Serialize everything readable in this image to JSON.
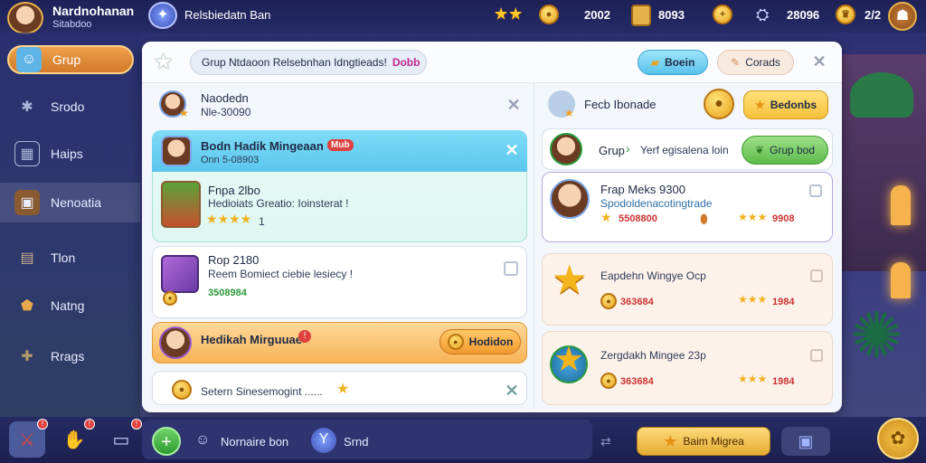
{
  "top": {
    "player_name": "Nardnohanan",
    "player_sub": "Sitabdoo",
    "guild_name": "Relsbiedatn Ban",
    "stars_value": "2002",
    "chest_value": "8093",
    "gear_value": "28096",
    "right_value": "2/2"
  },
  "sidebar": {
    "items": [
      {
        "label": "Grup"
      },
      {
        "label": "Srodo"
      },
      {
        "label": "Haips"
      },
      {
        "label": "Nenoatia"
      },
      {
        "label": "Tlon"
      },
      {
        "label": "Natng"
      },
      {
        "label": "Rrags"
      }
    ]
  },
  "panel": {
    "header_text": "Grup Ntdaoon Relsebnhan Idngtieads!",
    "header_tag": "Dobb",
    "btn_primary": "Boein",
    "btn_secondary": "Corads",
    "left": {
      "user_name": "Naodedn",
      "user_sub": "Nle-30090",
      "banner_title": "Bodn Hadik Mingeaan",
      "banner_badge": "Mub",
      "banner_sub": "Onn 5-08903",
      "item1_title": "Fnpa 2lbo",
      "item1_desc": "Hedioiats Greatio: Ioinsterat !",
      "item1_rating": "1",
      "item2_title": "Rop 2180",
      "item2_desc": "Reem Bomiect ciebie lesiecy !",
      "item2_value": "3508984",
      "orange_title": "Hedikah Mirguuae",
      "orange_button": "Hodidon",
      "footer_text": "Setern Sinesemogint ......"
    },
    "right": {
      "title": "Fecb Ibonade",
      "button": "Bedonbs",
      "row1_label": "Grup",
      "row1_text": "Yerf egisalena loin",
      "row1_button": "Grup bod",
      "card1_title": "Frap Meks 9300",
      "card1_sub": "Spodoldenacotingtrade",
      "card1_value": "5508800",
      "card1_rating": "9908",
      "card2_title": "Eapdehn Wingye Ocp",
      "card2_value": "363684",
      "card2_rating": "1984",
      "card3_title": "Zergdakh Mingee 23p",
      "card3_value": "363684",
      "card3_rating": "1984"
    }
  },
  "bottom": {
    "btn1_label": "Nornaire bon",
    "btn2_label": "Srnd",
    "action_label": "Baim Migrea"
  }
}
